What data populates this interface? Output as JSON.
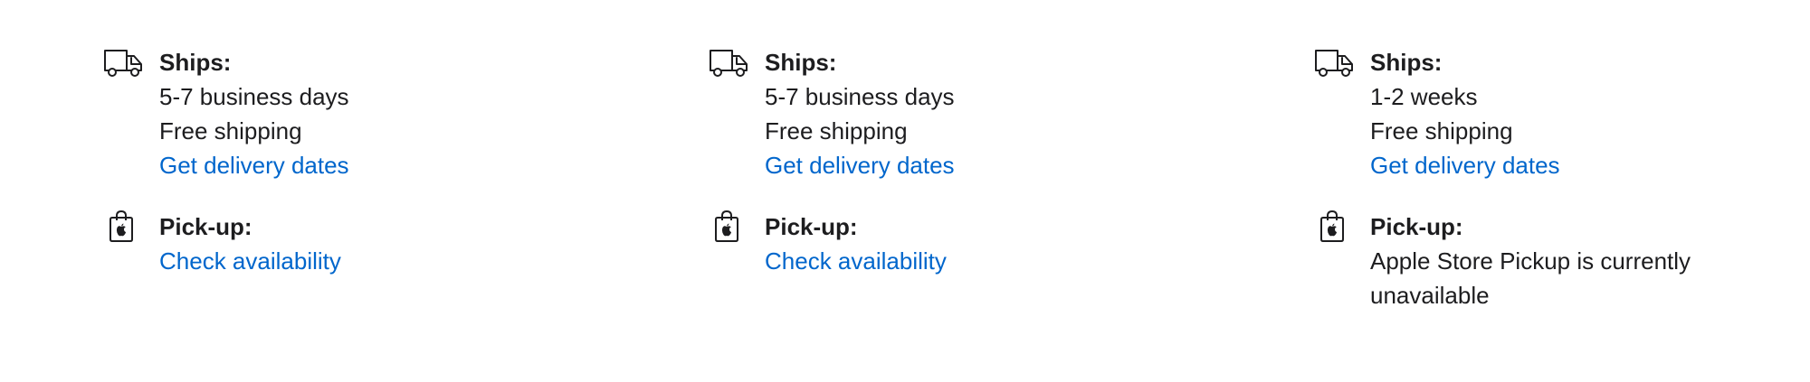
{
  "colors": {
    "text": "#1d1d1f",
    "link": "#0066cc",
    "background": "#ffffff"
  },
  "icons": {
    "ship": "delivery-truck-icon",
    "pickup": "shopping-bag-apple-icon"
  },
  "columns": [
    {
      "ships": {
        "heading": "Ships:",
        "timeframe": "5-7 business days",
        "cost": "Free shipping",
        "link": "Get delivery dates"
      },
      "pickup": {
        "heading": "Pick-up:",
        "link": "Check availability"
      }
    },
    {
      "ships": {
        "heading": "Ships:",
        "timeframe": "5-7 business days",
        "cost": "Free shipping",
        "link": "Get delivery dates"
      },
      "pickup": {
        "heading": "Pick-up:",
        "link": "Check availability"
      }
    },
    {
      "ships": {
        "heading": "Ships:",
        "timeframe": "1-2 weeks",
        "cost": "Free shipping",
        "link": "Get delivery dates"
      },
      "pickup": {
        "heading": "Pick-up:",
        "status": "Apple Store Pickup is currently unavailable"
      }
    }
  ]
}
